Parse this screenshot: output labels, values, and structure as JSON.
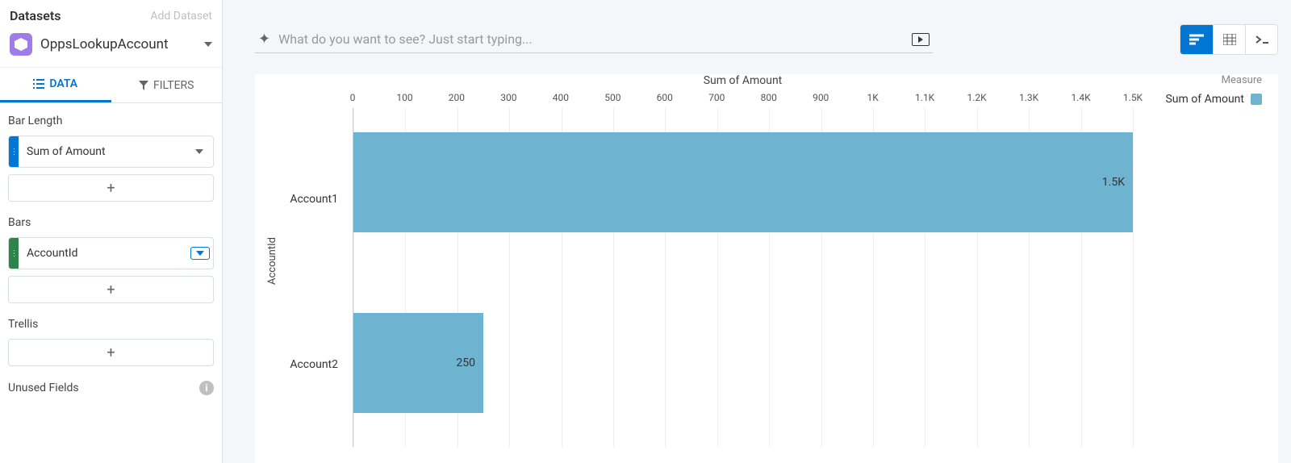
{
  "sidebar": {
    "title": "Datasets",
    "add_dataset": "Add Dataset",
    "dataset_name": "OppsLookupAccount",
    "tabs": {
      "data": "DATA",
      "filters": "FILTERS"
    },
    "sections": {
      "bar_length": "Bar Length",
      "bars": "Bars",
      "trellis": "Trellis",
      "unused": "Unused Fields"
    },
    "pills": {
      "sum_amount": "Sum of Amount",
      "account_id": "AccountId"
    },
    "add": "+"
  },
  "search": {
    "placeholder": "What do you want to see? Just start typing..."
  },
  "chart": {
    "title": "Sum of Amount",
    "y_label": "AccountId",
    "legend_title": "Measure",
    "legend_item": "Sum of Amount"
  },
  "chart_data": {
    "type": "bar",
    "orientation": "horizontal",
    "categories": [
      "Account1",
      "Account2"
    ],
    "values": [
      1500,
      250
    ],
    "value_labels": [
      "1.5K",
      "250"
    ],
    "title": "Sum of Amount",
    "xlabel": "Sum of Amount",
    "ylabel": "AccountId",
    "xlim": [
      0,
      1500
    ],
    "ticks": [
      0,
      100,
      200,
      300,
      400,
      500,
      600,
      700,
      800,
      900,
      1000,
      1100,
      1200,
      1300,
      1400,
      1500
    ],
    "tick_labels": [
      "0",
      "100",
      "200",
      "300",
      "400",
      "500",
      "600",
      "700",
      "800",
      "900",
      "1K",
      "1.1K",
      "1.2K",
      "1.3K",
      "1.4K",
      "1.5K"
    ]
  }
}
